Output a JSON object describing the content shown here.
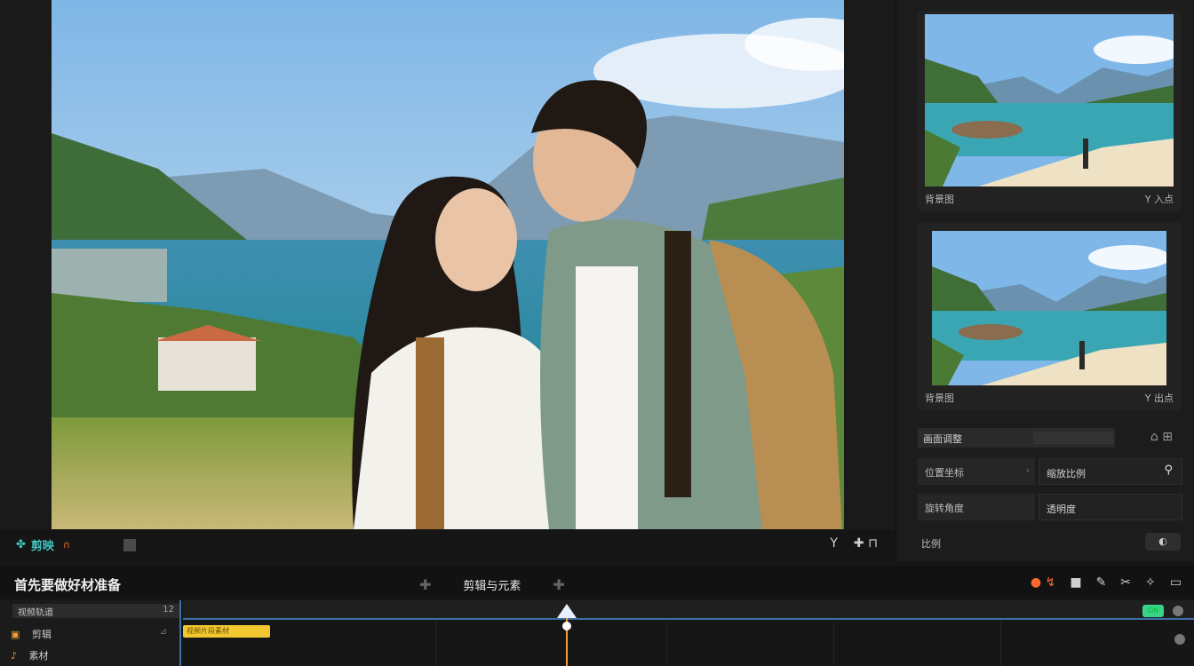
{
  "preview": {
    "brand_label": "剪映",
    "brand_tag": "∩",
    "controls": [
      "Y",
      "✚ ⊓"
    ]
  },
  "right_panel": {
    "thumbs": [
      {
        "caption_left": "背景图",
        "caption_right": "Y 入点"
      },
      {
        "caption_left": "背景图",
        "caption_right": "Y 出点"
      }
    ],
    "section_title": "画面调整",
    "properties": [
      {
        "label": "位置坐标",
        "value": "缩放比例"
      },
      {
        "label": "旋转角度",
        "value": "透明度"
      }
    ],
    "ratio_label": "比例",
    "ratio_toggle": "◐"
  },
  "toolbar": {
    "title": "首先要做好材准备",
    "center_label": "剪辑与元素"
  },
  "timeline": {
    "header_label": "视频轨道",
    "header_count": "12",
    "tracks": [
      {
        "label": "剪辑",
        "right": "⊿"
      },
      {
        "label": "素材"
      }
    ],
    "clip_label": "视频片段素材",
    "badge": "ON"
  },
  "colors": {
    "accent_blue": "#3a6fa8",
    "accent_orange": "#ff6a2a",
    "playhead": "#f0a030",
    "clip": "#f2c830",
    "brand_teal": "#43c6c0",
    "badge_green": "#39d38a"
  }
}
